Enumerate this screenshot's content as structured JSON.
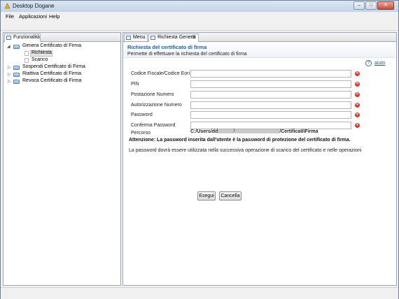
{
  "window": {
    "title": "Desktop Dogane"
  },
  "menu": {
    "items": [
      "File",
      "Applicazioni",
      "Help"
    ]
  },
  "left_panel": {
    "tab_label": "Funzionalità",
    "tree": {
      "genera": "Genera Certificato di Firma",
      "richiesta": "Richiesta",
      "scarico": "Scarico",
      "sospendi": "Sospendi Certificato di Firma",
      "riattiva": "Riattiva Certificato di Firma",
      "revoca": "Revoca Certificato di Firma"
    }
  },
  "right_panel": {
    "tabs": {
      "menu": "Menu",
      "richiesta": "Richiesta Genera"
    },
    "header": {
      "title": "Richiesta del certificato di firma",
      "description": "Permette di effettuare la richiesta del certificato di firma"
    },
    "help_link": "aiuto",
    "form": {
      "codice_fiscale": "Codice Fiscale/Codice Eori",
      "pin": "PIN",
      "postazione": "Postazione Numero",
      "autorizzazione": "Autorizzazione Numero",
      "password": "Password",
      "conferma": "Conferma Password",
      "percorso": "Percorso"
    },
    "path": {
      "prefix": "C:/Users/dd",
      "sep": "/",
      "suffix": "/Certificati\\Firma"
    },
    "warning": "Attenzione: La password inserita dall'utente è la password di protezione del certificato di firma.",
    "note": "La password dovrà essere utilizzata nella successiva operazione di scarico del certificato e nelle operazioni",
    "buttons": {
      "esegui": "Esegui",
      "cancella": "Cancella"
    }
  }
}
